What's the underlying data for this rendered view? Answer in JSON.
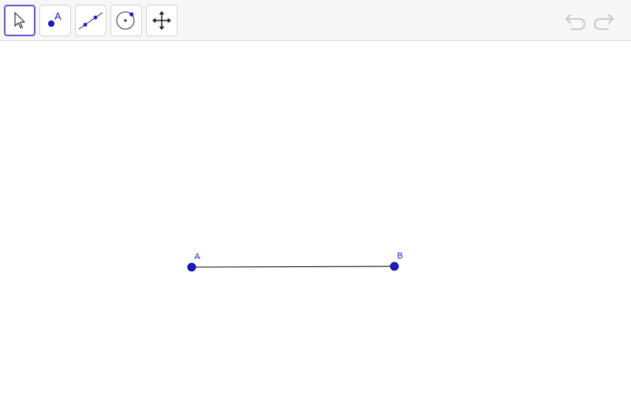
{
  "toolbar": {
    "tools": [
      {
        "name": "move-tool",
        "icon": "cursor-arrow-icon",
        "active": true
      },
      {
        "name": "point-tool",
        "icon": "point-icon",
        "label": "A"
      },
      {
        "name": "line-tool",
        "icon": "line-through-two-points-icon"
      },
      {
        "name": "circle-tool",
        "icon": "circle-center-point-icon"
      },
      {
        "name": "move-graphics-view-tool",
        "icon": "move-cross-arrows-icon"
      }
    ],
    "history": [
      {
        "name": "undo-button",
        "icon": "undo-icon"
      },
      {
        "name": "redo-button",
        "icon": "redo-icon"
      }
    ]
  },
  "colors": {
    "point_fill": "#1a1ad4",
    "segment": "#000000",
    "active_tool_border": "#6557d2",
    "toolbar_bg": "#f7f7f7",
    "history_icon": "#c8c8c8"
  },
  "construction": {
    "points": [
      {
        "label": "A"
      },
      {
        "label": "B"
      }
    ],
    "segment": {
      "from": "A",
      "to": "B"
    }
  }
}
